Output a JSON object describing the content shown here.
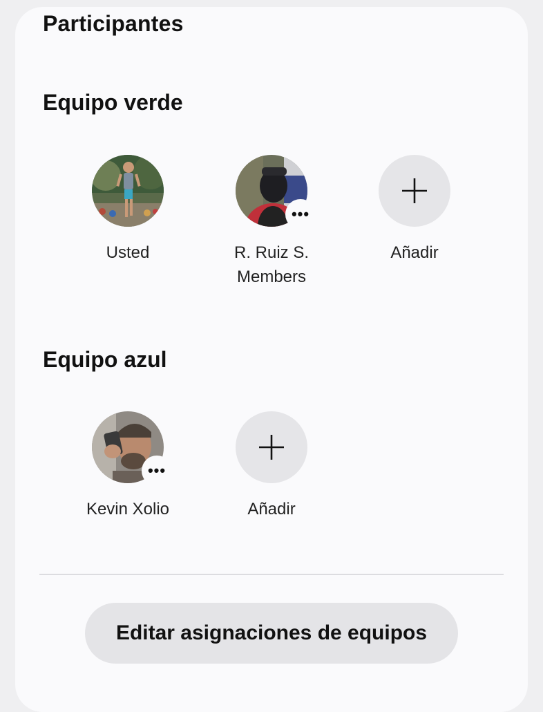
{
  "participants": {
    "title": "Participantes"
  },
  "team_green": {
    "title": "Equipo verde",
    "members": [
      {
        "name": "Usted"
      },
      {
        "name": "R. Ruiz S.",
        "subtitle": "Members",
        "more_icon": "more-dots-icon"
      }
    ],
    "add_label": "Añadir",
    "add_icon": "plus-icon"
  },
  "team_blue": {
    "title": "Equipo azul",
    "members": [
      {
        "name": "Kevin Xolio",
        "more_icon": "more-dots-icon"
      }
    ],
    "add_label": "Añadir",
    "add_icon": "plus-icon"
  },
  "footer": {
    "edit_button_label": "Editar asignaciones de equipos"
  },
  "colors": {
    "background": "#efeff1",
    "card": "#fafafc",
    "add_circle": "#e5e5e8",
    "button": "#e4e4e7"
  },
  "more_glyph": "•••"
}
